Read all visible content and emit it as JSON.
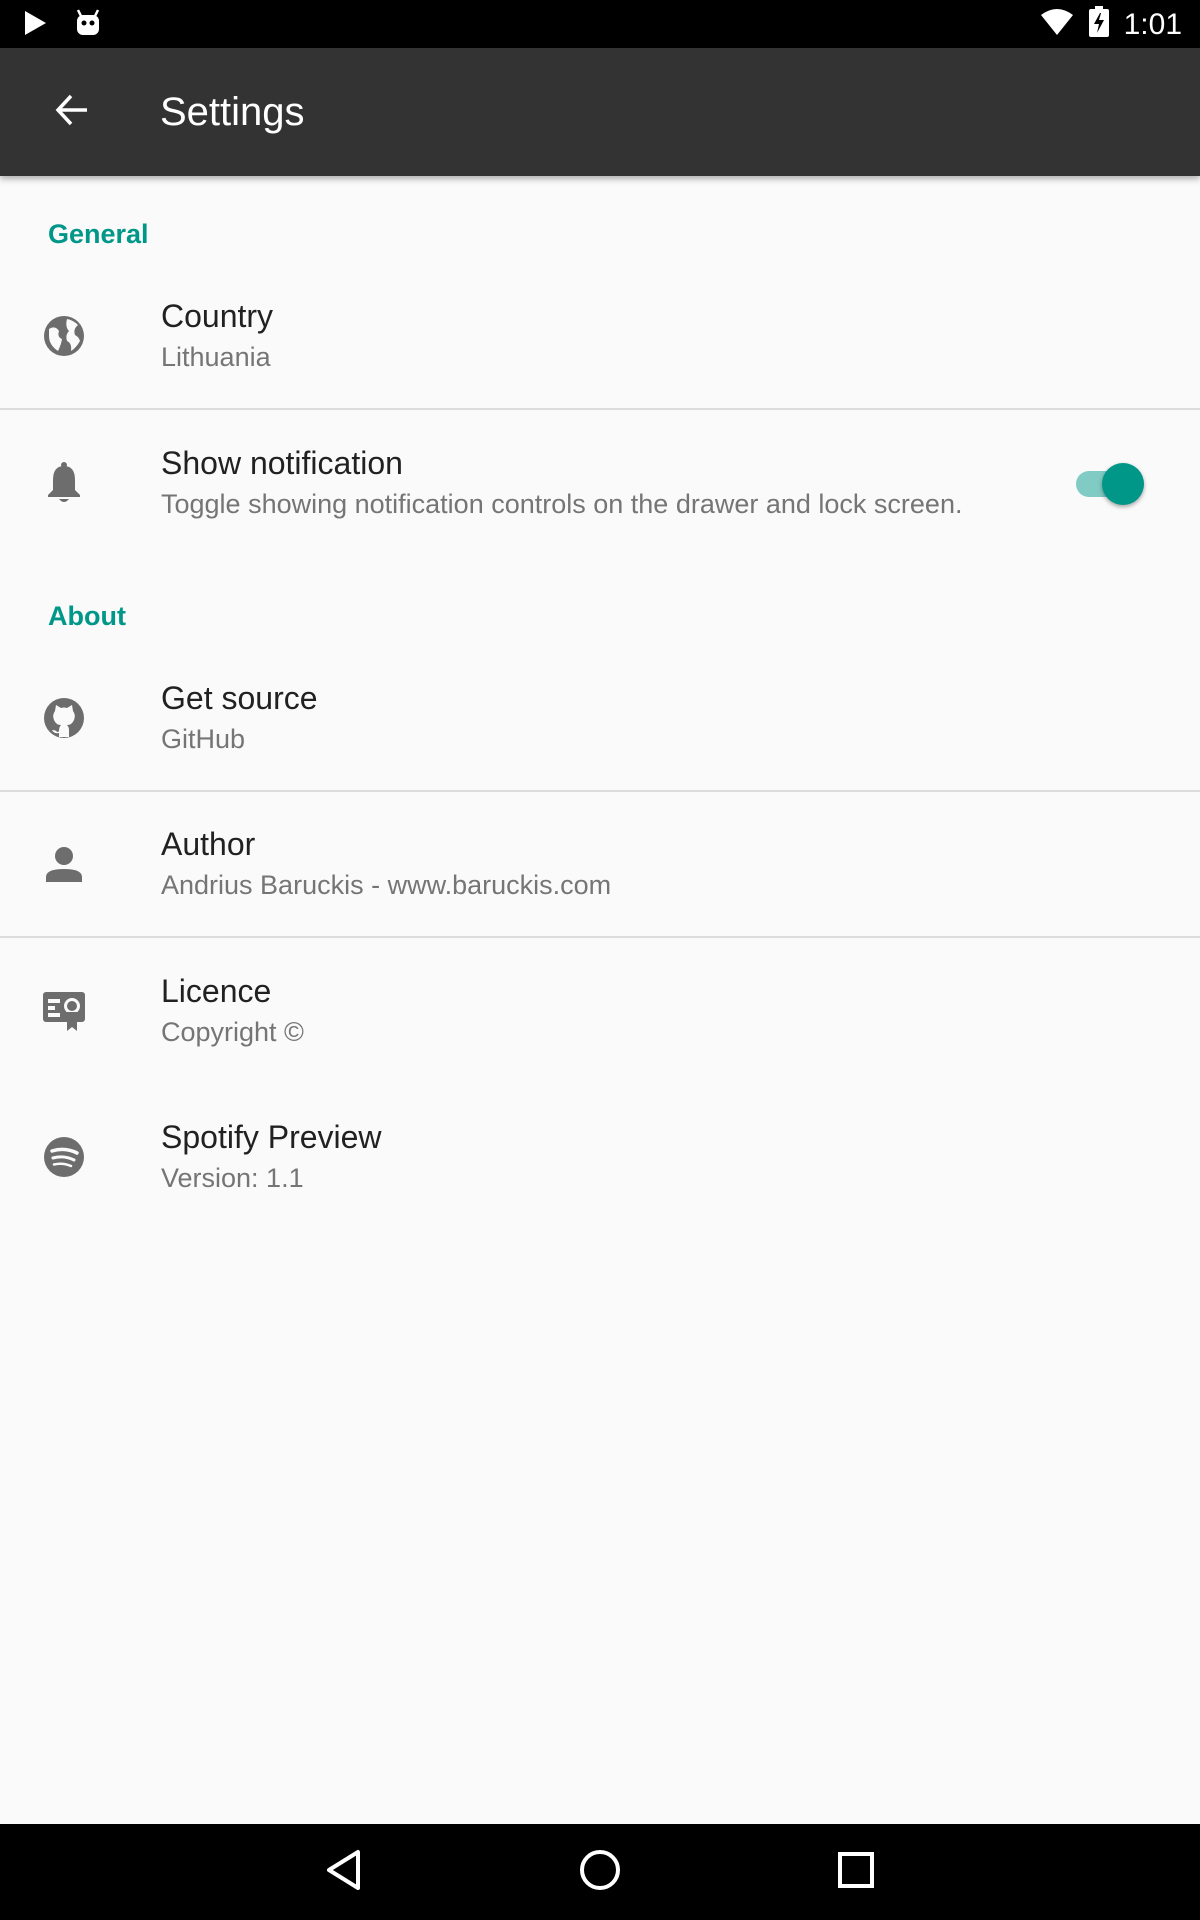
{
  "status_bar": {
    "time": "1:01",
    "icons": [
      "play-store-icon",
      "android-debug-icon",
      "wifi-icon",
      "battery-charging-icon"
    ]
  },
  "app_bar": {
    "title": "Settings",
    "back_icon": "arrow-back-icon"
  },
  "sections": {
    "general": {
      "header": "General",
      "country": {
        "icon": "globe-icon",
        "title": "Country",
        "summary": "Lithuania"
      },
      "notification": {
        "icon": "bell-icon",
        "title": "Show notification",
        "summary": "Toggle showing notification controls on the drawer and lock screen.",
        "enabled": true
      }
    },
    "about": {
      "header": "About",
      "source": {
        "icon": "github-icon",
        "title": "Get source",
        "summary": "GitHub"
      },
      "author": {
        "icon": "person-icon",
        "title": "Author",
        "summary": "Andrius Baruckis - www.baruckis.com"
      },
      "licence": {
        "icon": "licence-card-icon",
        "title": "Licence",
        "summary": "Copyright ©"
      },
      "app": {
        "icon": "spotify-icon",
        "title": "Spotify Preview",
        "summary": "Version: 1.1"
      }
    }
  },
  "colors": {
    "accent": "#009688",
    "app_bar": "#333333",
    "background": "#fafafa"
  },
  "nav_bar": {
    "icons": [
      "nav-back-icon",
      "nav-home-icon",
      "nav-recents-icon"
    ]
  }
}
